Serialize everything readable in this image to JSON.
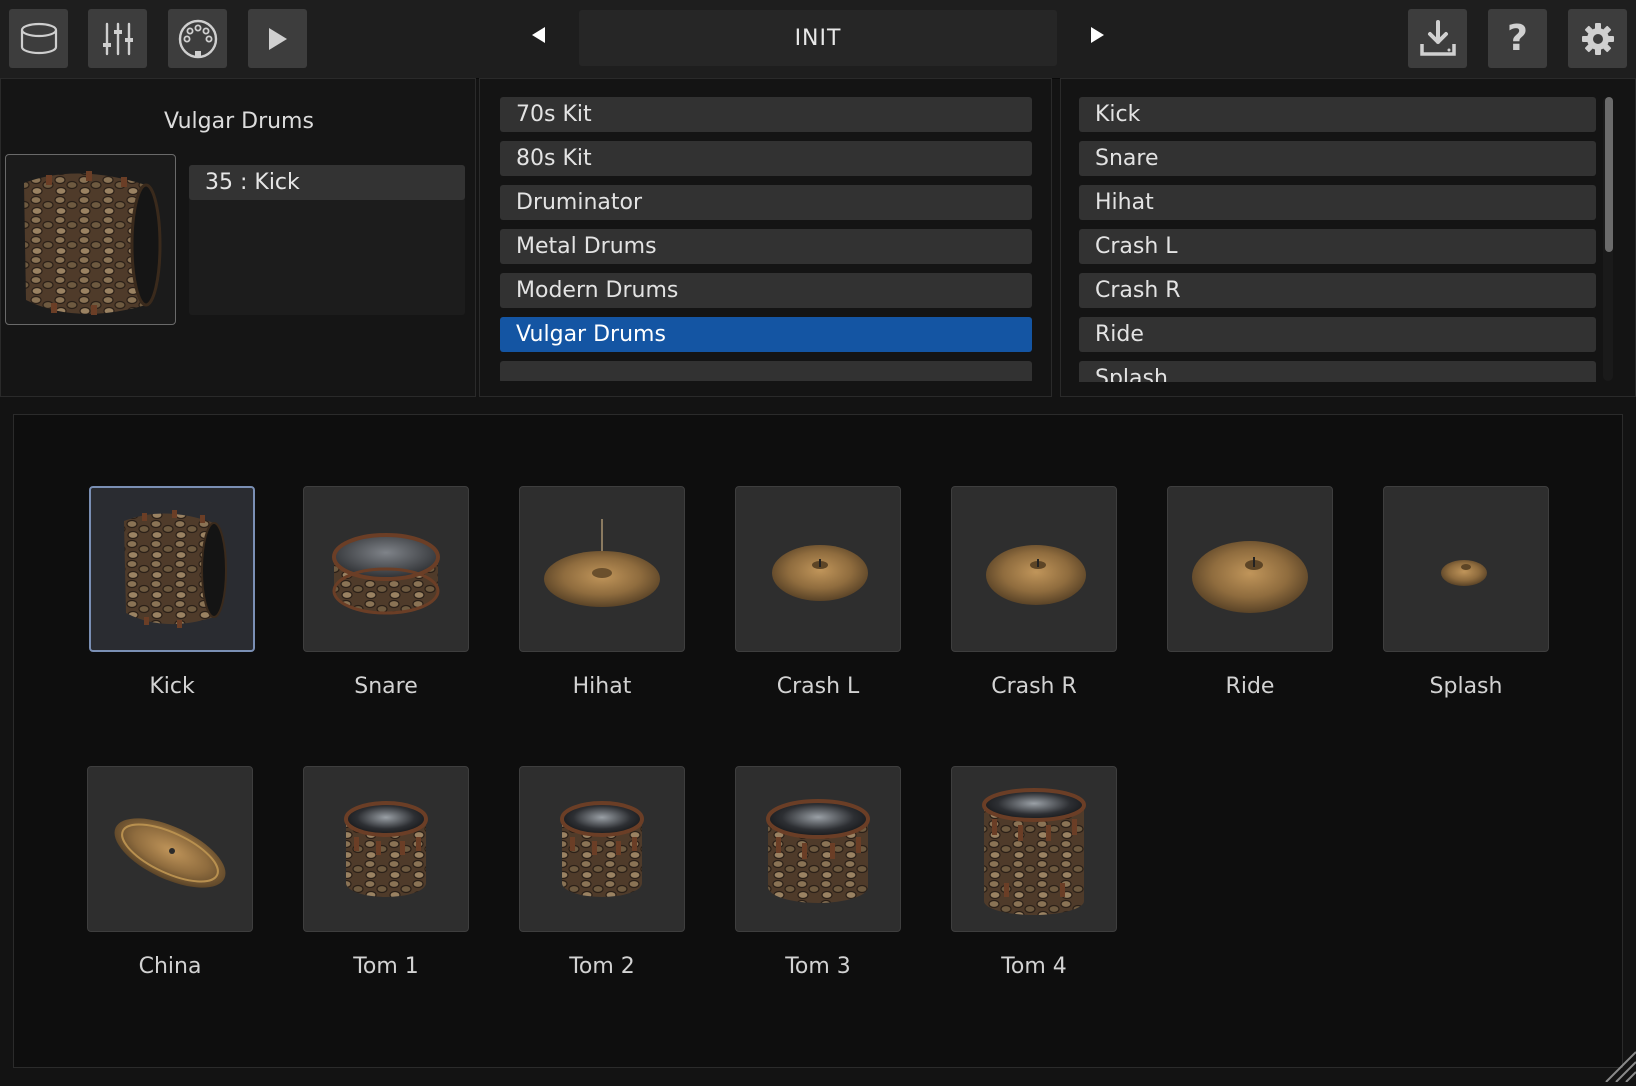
{
  "toolbar": {
    "buttons": [
      {
        "name": "kit-view-button",
        "icon": "drum-icon"
      },
      {
        "name": "mixer-button",
        "icon": "mixer-sliders-icon"
      },
      {
        "name": "midi-button",
        "icon": "midi-connector-icon"
      },
      {
        "name": "play-button",
        "icon": "play-icon"
      }
    ],
    "preset_name": "INIT",
    "prev_icon": "triangle-left-icon",
    "next_icon": "triangle-right-icon",
    "right_buttons": [
      {
        "name": "download-button",
        "icon": "download-icon"
      },
      {
        "name": "help-button",
        "icon": "question-mark-icon",
        "glyph": "?"
      },
      {
        "name": "settings-button",
        "icon": "gear-icon"
      }
    ]
  },
  "info_panel": {
    "kit_name": "Vulgar Drums",
    "note_entry": "35 : Kick"
  },
  "kit_list": {
    "items": [
      "70s Kit",
      "80s Kit",
      "Druminator",
      "Metal Drums",
      "Modern Drums",
      "Vulgar Drums"
    ],
    "selected": "Vulgar Drums"
  },
  "instrument_list": {
    "items": [
      "Kick",
      "Snare",
      "Hihat",
      "Crash L",
      "Crash R",
      "Ride",
      "Splash"
    ]
  },
  "pads": [
    {
      "label": "Kick",
      "kind": "kick",
      "selected": true
    },
    {
      "label": "Snare",
      "kind": "snare"
    },
    {
      "label": "Hihat",
      "kind": "hihat"
    },
    {
      "label": "Crash L",
      "kind": "crash"
    },
    {
      "label": "Crash R",
      "kind": "crash"
    },
    {
      "label": "Ride",
      "kind": "ride"
    },
    {
      "label": "Splash",
      "kind": "splash"
    },
    {
      "label": "China",
      "kind": "china"
    },
    {
      "label": "Tom 1",
      "kind": "tom"
    },
    {
      "label": "Tom 2",
      "kind": "tom"
    },
    {
      "label": "Tom 3",
      "kind": "tom-large"
    },
    {
      "label": "Tom 4",
      "kind": "floor-tom"
    }
  ],
  "colors": {
    "accent": "#1455a3",
    "selected_pad_border": "#7a8fb4",
    "cymbal": "#8a6a3e",
    "shell": "#5a4330"
  }
}
